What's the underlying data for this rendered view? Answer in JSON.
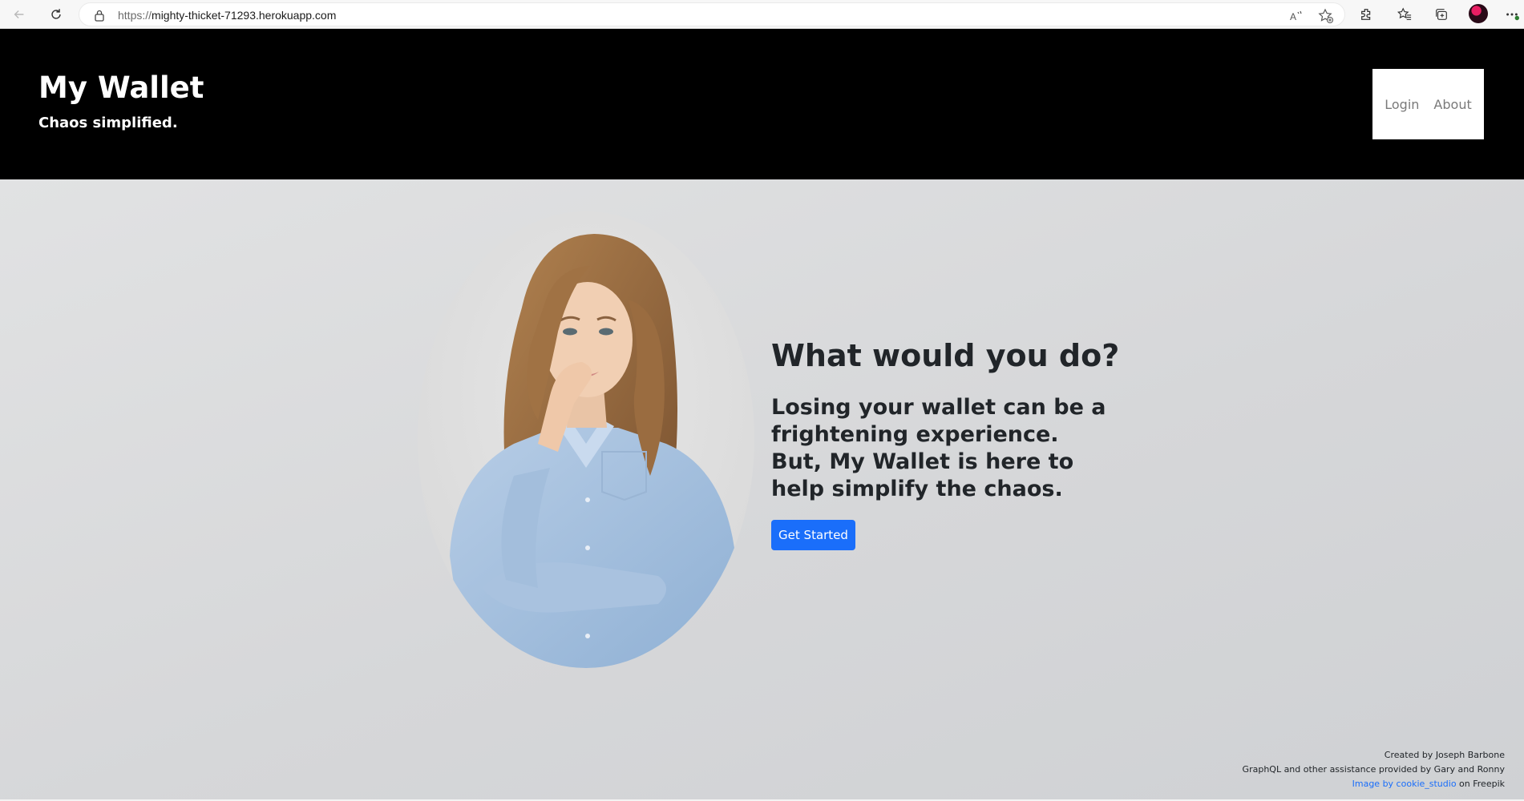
{
  "browser": {
    "url_protocol": "https://",
    "url_host": "mighty-thicket-71293.herokuapp.com"
  },
  "header": {
    "title": "My Wallet",
    "tagline": "Chaos simplified.",
    "nav": {
      "login_label": "Login",
      "about_label": "About"
    }
  },
  "hero": {
    "heading": "What would you do?",
    "text": "Losing your wallet can be a frightening experience. But, My Wallet is here to help simplify the chaos.",
    "button_label": "Get Started",
    "image_alt": "Woman in blue shirt looking worried"
  },
  "footer": {
    "created_by": "Created by Joseph Barbone",
    "assistance": "GraphQL and other assistance provided by Gary and Ronny",
    "image_credit_link": "Image by cookie_studio",
    "image_credit_suffix": " on Freepik"
  },
  "colors": {
    "header_bg": "#000000",
    "accent_button": "#1a6efa",
    "hero_bg": "#d9dadc",
    "text_dark": "#212529"
  },
  "icons": [
    "back-arrow-icon",
    "refresh-icon",
    "lock-icon",
    "read-aloud-icon",
    "add-favorite-icon",
    "extensions-icon",
    "favorites-icon",
    "collections-icon",
    "profile-avatar",
    "more-icon"
  ]
}
